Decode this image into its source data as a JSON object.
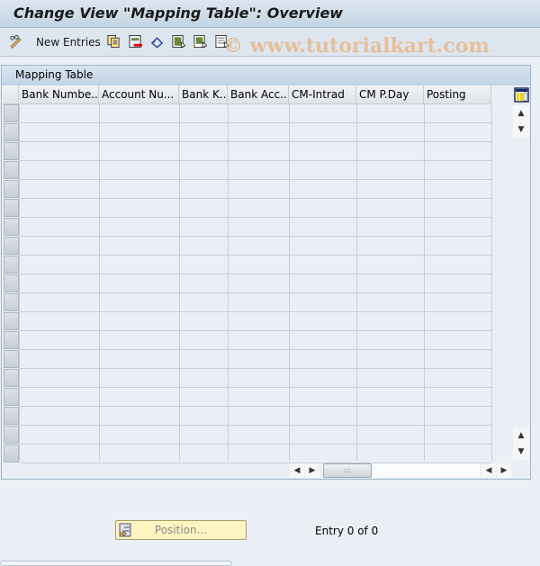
{
  "title": "Change View \"Mapping Table\": Overview",
  "toolbar": {
    "new_entries_label": "New Entries",
    "icons": [
      "edit-glasses-icon",
      "copy-icon",
      "delete-icon",
      "undo-icon",
      "select-all-icon",
      "select-block-icon",
      "deselect-all-icon"
    ]
  },
  "watermark": "© www.tutorialkart.com",
  "table": {
    "title": "Mapping Table",
    "columns": [
      "Bank Numbe...",
      "Account Nu...",
      "Bank K...",
      "Bank Acc...",
      "CM-Intrad",
      "CM P.Day",
      "Posting"
    ],
    "rows": []
  },
  "footer": {
    "position_label": "Position...",
    "entry_text": "Entry 0 of 0"
  }
}
